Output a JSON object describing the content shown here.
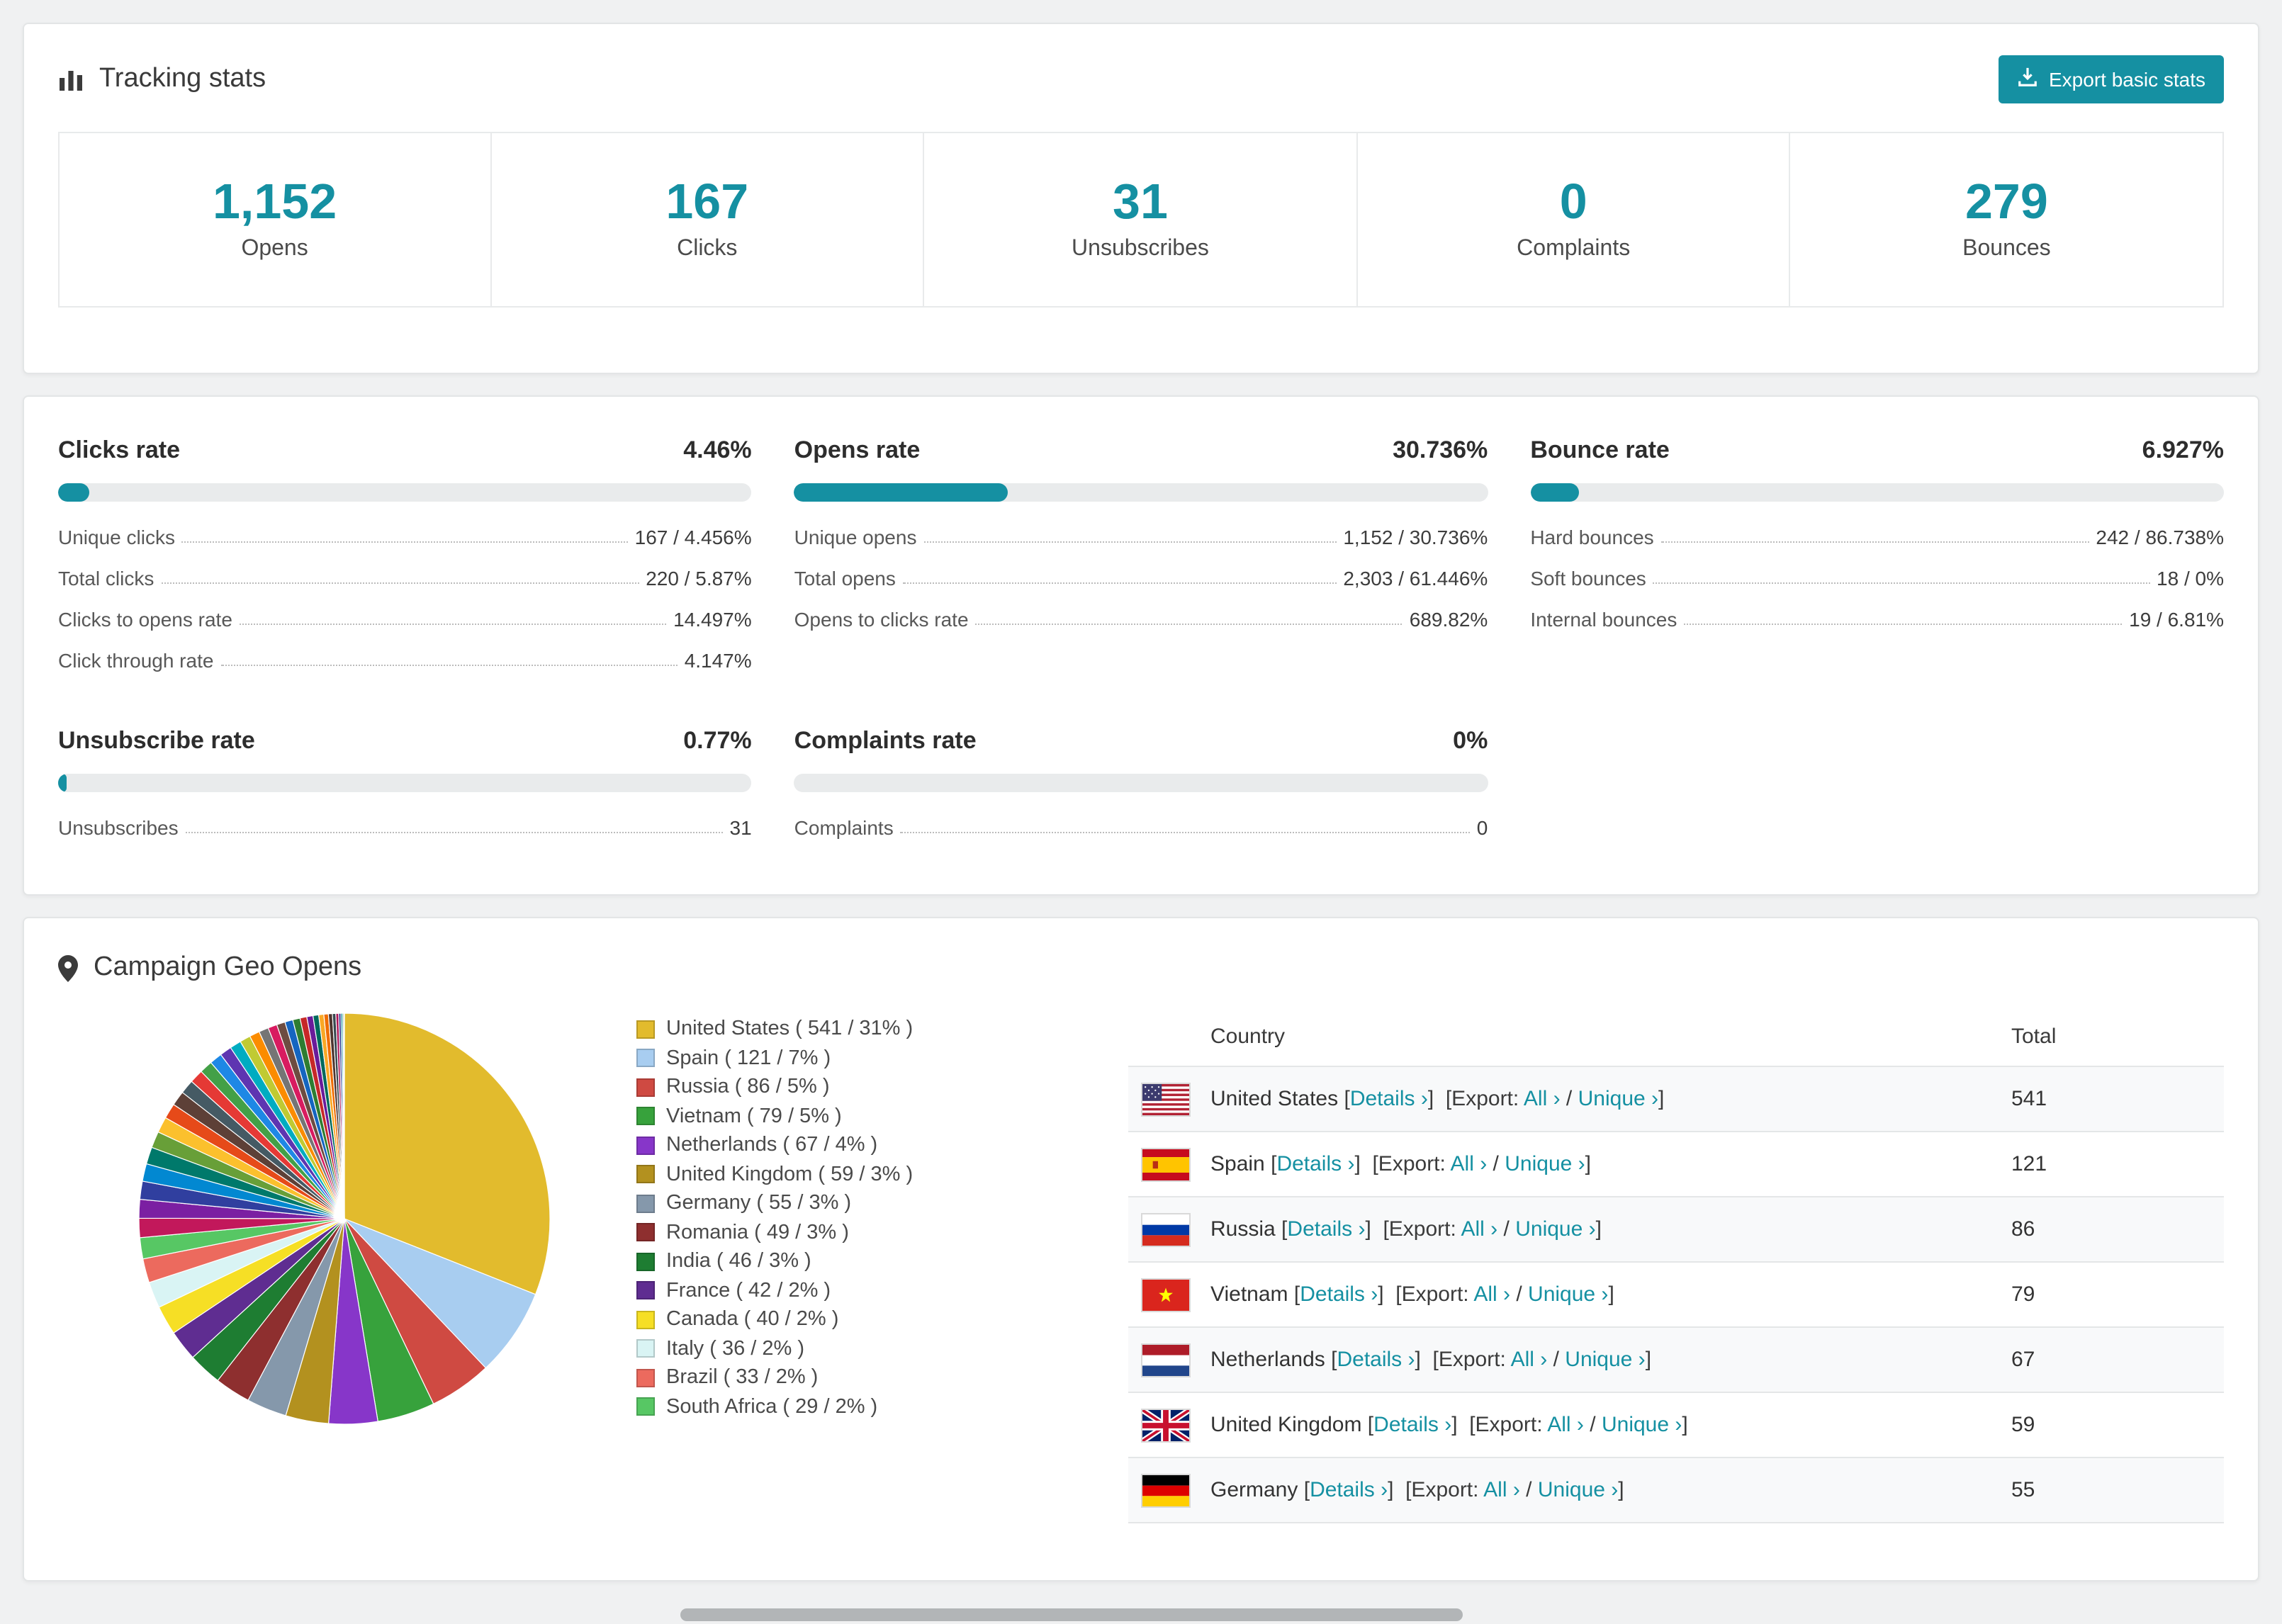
{
  "accent_color": "#1590a2",
  "tracking": {
    "title": "Tracking stats",
    "export_label": "Export basic stats",
    "stats": [
      {
        "value": "1,152",
        "label": "Opens"
      },
      {
        "value": "167",
        "label": "Clicks"
      },
      {
        "value": "31",
        "label": "Unsubscribes"
      },
      {
        "value": "0",
        "label": "Complaints"
      },
      {
        "value": "279",
        "label": "Bounces"
      }
    ]
  },
  "rates": {
    "panels": [
      {
        "title": "Clicks rate",
        "pct_label": "4.46%",
        "bar_pct": 4.46,
        "rows": [
          {
            "label": "Unique clicks",
            "value": "167 / 4.456%"
          },
          {
            "label": "Total clicks",
            "value": "220 / 5.87%"
          },
          {
            "label": "Clicks to opens rate",
            "value": "14.497%"
          },
          {
            "label": "Click through rate",
            "value": "4.147%"
          }
        ]
      },
      {
        "title": "Opens rate",
        "pct_label": "30.736%",
        "bar_pct": 30.736,
        "rows": [
          {
            "label": "Unique opens",
            "value": "1,152 / 30.736%"
          },
          {
            "label": "Total opens",
            "value": "2,303 / 61.446%"
          },
          {
            "label": "Opens to clicks rate",
            "value": "689.82%"
          }
        ]
      },
      {
        "title": "Bounce rate",
        "pct_label": "6.927%",
        "bar_pct": 6.927,
        "rows": [
          {
            "label": "Hard bounces",
            "value": "242 / 86.738%"
          },
          {
            "label": "Soft bounces",
            "value": "18 / 0%"
          },
          {
            "label": "Internal bounces",
            "value": "19 / 6.81%"
          }
        ]
      },
      {
        "title": "Unsubscribe rate",
        "pct_label": "0.77%",
        "bar_pct": 0.77,
        "rows": [
          {
            "label": "Unsubscribes",
            "value": "31"
          }
        ]
      },
      {
        "title": "Complaints rate",
        "pct_label": "0%",
        "bar_pct": 0,
        "rows": [
          {
            "label": "Complaints",
            "value": "0"
          }
        ]
      }
    ]
  },
  "geo": {
    "title": "Campaign Geo Opens",
    "table": {
      "headers": {
        "country": "Country",
        "total": "Total"
      },
      "details_label": "Details",
      "export_label": "Export:",
      "all_label": "All",
      "unique_label": "Unique",
      "chevron": "›",
      "rows": [
        {
          "flag": "us",
          "country": "United States",
          "total": "541"
        },
        {
          "flag": "es",
          "country": "Spain",
          "total": "121"
        },
        {
          "flag": "ru",
          "country": "Russia",
          "total": "86"
        },
        {
          "flag": "vn",
          "country": "Vietnam",
          "total": "79"
        },
        {
          "flag": "nl",
          "country": "Netherlands",
          "total": "67"
        },
        {
          "flag": "gb",
          "country": "United Kingdom",
          "total": "59"
        },
        {
          "flag": "de",
          "country": "Germany",
          "total": "55"
        }
      ]
    }
  },
  "chart_data": {
    "type": "pie",
    "title": "Campaign Geo Opens",
    "legend_position": "right",
    "entries": [
      {
        "name": "United States",
        "value": 541,
        "pct": 31,
        "color": "#e2bb2d"
      },
      {
        "name": "Spain",
        "value": 121,
        "pct": 7,
        "color": "#a8cdf0"
      },
      {
        "name": "Russia",
        "value": 86,
        "pct": 5,
        "color": "#cf4a42"
      },
      {
        "name": "Vietnam",
        "value": 79,
        "pct": 5,
        "color": "#37a23c"
      },
      {
        "name": "Netherlands",
        "value": 67,
        "pct": 4,
        "color": "#8736c9"
      },
      {
        "name": "United Kingdom",
        "value": 59,
        "pct": 3,
        "color": "#b3911f"
      },
      {
        "name": "Germany",
        "value": 55,
        "pct": 3,
        "color": "#8598ab"
      },
      {
        "name": "Romania",
        "value": 49,
        "pct": 3,
        "color": "#8e2f2f"
      },
      {
        "name": "India",
        "value": 46,
        "pct": 3,
        "color": "#1e7d32"
      },
      {
        "name": "France",
        "value": 42,
        "pct": 2,
        "color": "#5f2d91"
      },
      {
        "name": "Canada",
        "value": 40,
        "pct": 2,
        "color": "#f6df25"
      },
      {
        "name": "Italy",
        "value": 36,
        "pct": 2,
        "color": "#d9f4f4"
      },
      {
        "name": "Brazil",
        "value": 33,
        "pct": 2,
        "color": "#ec6a5e"
      },
      {
        "name": "South Africa",
        "value": 29,
        "pct": 2,
        "color": "#57c764"
      }
    ],
    "others_total": 462,
    "others_slice_count": 34,
    "others_palette": [
      "#c2185b",
      "#7b1fa2",
      "#303f9f",
      "#0288d1",
      "#00796b",
      "#689f38",
      "#fbc02d",
      "#e64a19",
      "#5d4037",
      "#455a64",
      "#e53935",
      "#43a047",
      "#1e88e5",
      "#5e35b1",
      "#00acc1",
      "#c0ca33",
      "#fb8c00",
      "#757575",
      "#d81b60",
      "#6d4c41",
      "#1565c0",
      "#2e7d32",
      "#c62828",
      "#6a1b9a",
      "#00695c",
      "#f9a825",
      "#ef6c00",
      "#4e342e",
      "#37474f",
      "#ad1457",
      "#283593",
      "#00838f",
      "#558b2f",
      "#ff8f00"
    ]
  }
}
